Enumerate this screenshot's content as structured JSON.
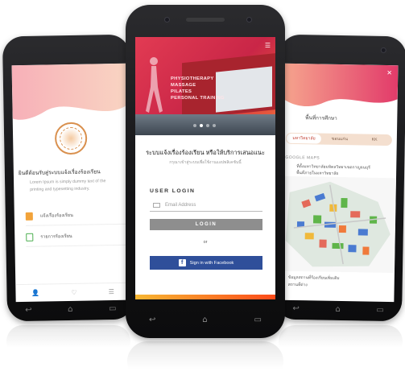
{
  "left_phone": {
    "welcome_text": "ยินดีต้อนรับสู่ระบบแจ้งเรื่องร้องเรียน",
    "lorem_line1": "Lorem Ipsum is simply dummy text of the",
    "lorem_line2": "printing and typesetting industry.",
    "menu": [
      {
        "label": "แจ้งเรื่องร้องเรียน",
        "icon": "alert-icon",
        "color": "#f2a33a"
      },
      {
        "label": "รายการร้องเรียน",
        "icon": "document-icon",
        "color": "#4caf50"
      }
    ],
    "tab_icons": [
      "user-icon",
      "like-icon",
      "list-icon"
    ]
  },
  "center_phone": {
    "hero": {
      "sign_lines": [
        "PHYSIOTHERAPY",
        "MASSAGE",
        "PILATES",
        "PERSONAL TRAINING"
      ],
      "dots": 4,
      "active_dot": 1
    },
    "title": "ระบบแจ้งเรื่องร้องเรียน หรือให้บริการเสนอแนะ",
    "subtitle": "กรุณาเข้าสู่ระบบเพื่อใช้งานแอปพลิเคชันนี้",
    "login_heading": "USER LOGIN",
    "email_placeholder": "Email Address",
    "login_button": "LOGIN",
    "or_text": "or",
    "facebook_button": "Sign in with Facebook",
    "accent_colors": {
      "primary": "#c92647",
      "facebook": "#2f4f9a",
      "login": "#8e8e8e"
    }
  },
  "right_phone": {
    "title": "พื้นที่การศึกษา",
    "tabs": [
      "มหาวิทยาลัย",
      "ขอนแก่น",
      "KK"
    ],
    "active_tab": 0,
    "google_maps_label": "GOOGLE MAPS",
    "desc_line1": "ที่ตั้งมหาวิทยาลัยมหิดลวิทยาเขตกาญจนบุรี",
    "desc_line2": "พื้นที่ภายในมหาวิทยาลัย",
    "bottom_line1": "ข้อมูลสถานที่ร้องเรียนเพิ่มเติม",
    "bottom_line2": "สถานที่ต่าง"
  },
  "softkeys": [
    "back-key",
    "home-key",
    "recents-key"
  ]
}
